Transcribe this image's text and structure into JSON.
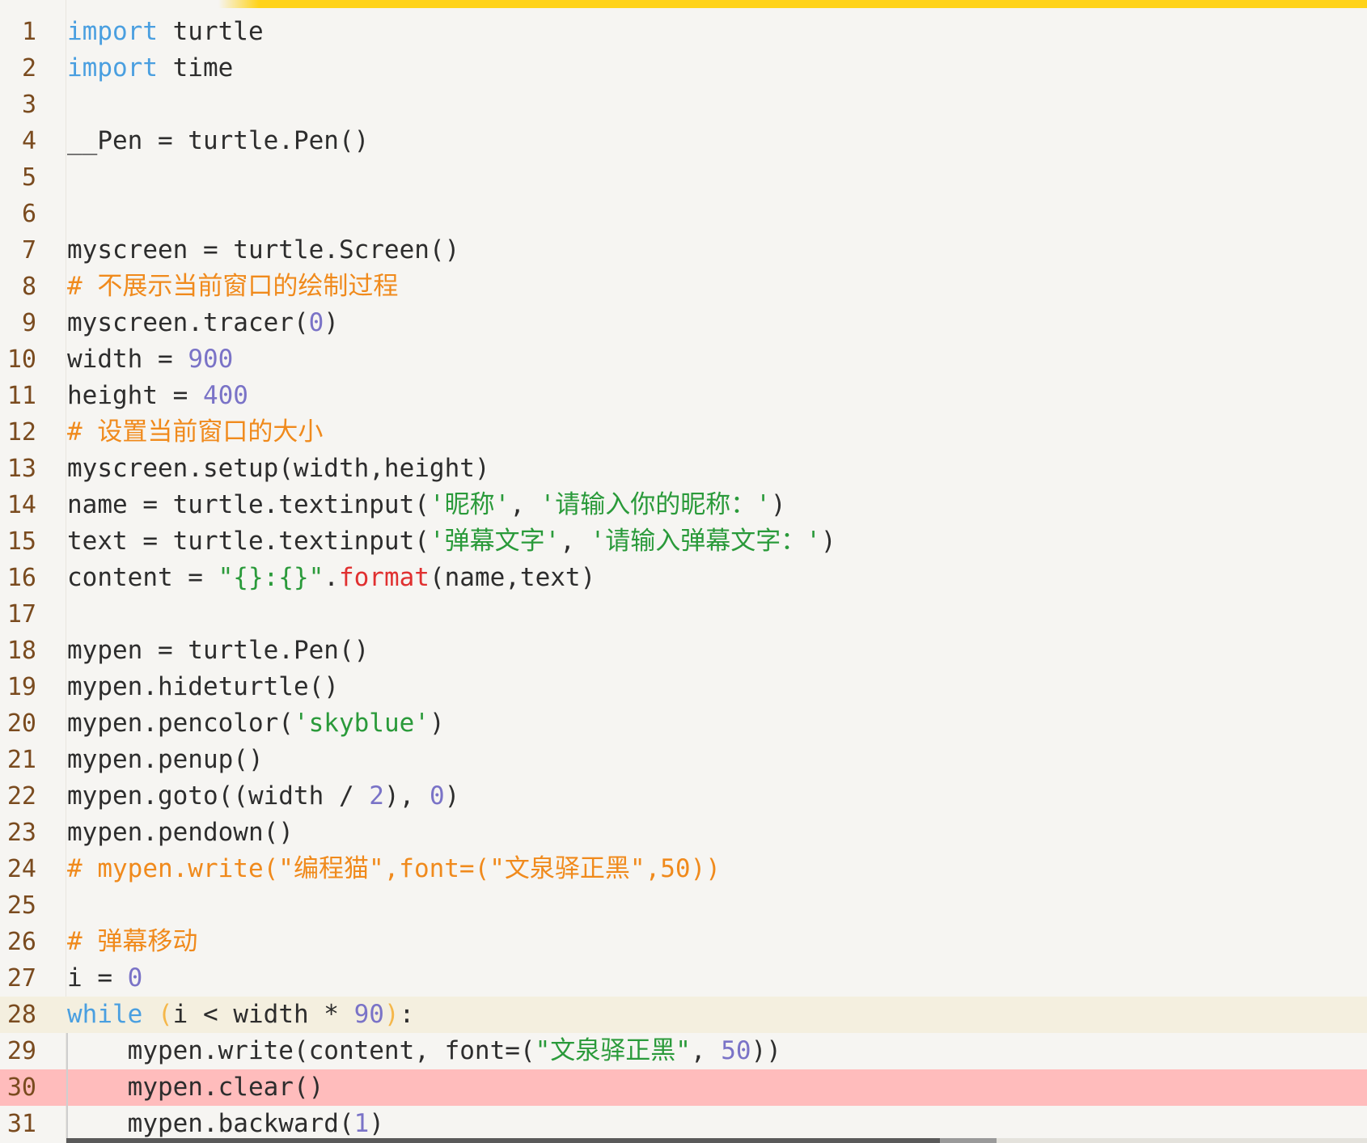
{
  "editor": {
    "language": "python",
    "active_line": 28,
    "error_line": 30,
    "lines": [
      {
        "num": "1",
        "tokens": [
          {
            "t": "import",
            "k": "kw"
          },
          {
            "t": " turtle",
            "k": "p"
          }
        ]
      },
      {
        "num": "2",
        "tokens": [
          {
            "t": "import",
            "k": "kw"
          },
          {
            "t": " time",
            "k": "p"
          }
        ]
      },
      {
        "num": "3",
        "tokens": []
      },
      {
        "num": "4",
        "tokens": [
          {
            "t": "__Pen = turtle.Pen()",
            "k": "p"
          }
        ]
      },
      {
        "num": "5",
        "tokens": []
      },
      {
        "num": "6",
        "tokens": []
      },
      {
        "num": "7",
        "tokens": [
          {
            "t": "myscreen = turtle.Screen()",
            "k": "p"
          }
        ]
      },
      {
        "num": "8",
        "tokens": [
          {
            "t": "# 不展示当前窗口的绘制过程",
            "k": "com"
          }
        ]
      },
      {
        "num": "9",
        "tokens": [
          {
            "t": "myscreen.tracer(",
            "k": "p"
          },
          {
            "t": "0",
            "k": "num"
          },
          {
            "t": ")",
            "k": "p"
          }
        ]
      },
      {
        "num": "10",
        "tokens": [
          {
            "t": "width = ",
            "k": "p"
          },
          {
            "t": "900",
            "k": "num"
          }
        ]
      },
      {
        "num": "11",
        "tokens": [
          {
            "t": "height = ",
            "k": "p"
          },
          {
            "t": "400",
            "k": "num"
          }
        ]
      },
      {
        "num": "12",
        "tokens": [
          {
            "t": "# 设置当前窗口的大小",
            "k": "com"
          }
        ]
      },
      {
        "num": "13",
        "tokens": [
          {
            "t": "myscreen.setup(width,height)",
            "k": "p"
          }
        ]
      },
      {
        "num": "14",
        "tokens": [
          {
            "t": "name = turtle.textinput(",
            "k": "p"
          },
          {
            "t": "'昵称'",
            "k": "str"
          },
          {
            "t": ", ",
            "k": "p"
          },
          {
            "t": "'请输入你的昵称：'",
            "k": "str"
          },
          {
            "t": ")",
            "k": "p"
          }
        ]
      },
      {
        "num": "15",
        "tokens": [
          {
            "t": "text = turtle.textinput(",
            "k": "p"
          },
          {
            "t": "'弹幕文字'",
            "k": "str"
          },
          {
            "t": ", ",
            "k": "p"
          },
          {
            "t": "'请输入弹幕文字：'",
            "k": "str"
          },
          {
            "t": ")",
            "k": "p"
          }
        ]
      },
      {
        "num": "16",
        "tokens": [
          {
            "t": "content = ",
            "k": "p"
          },
          {
            "t": "\"{}:{}\"",
            "k": "str"
          },
          {
            "t": ".",
            "k": "p"
          },
          {
            "t": "format",
            "k": "fn"
          },
          {
            "t": "(name,text)",
            "k": "p"
          }
        ]
      },
      {
        "num": "17",
        "tokens": []
      },
      {
        "num": "18",
        "tokens": [
          {
            "t": "mypen = turtle.Pen()",
            "k": "p"
          }
        ]
      },
      {
        "num": "19",
        "tokens": [
          {
            "t": "mypen.hideturtle()",
            "k": "p"
          }
        ]
      },
      {
        "num": "20",
        "tokens": [
          {
            "t": "mypen.pencolor(",
            "k": "p"
          },
          {
            "t": "'skyblue'",
            "k": "str"
          },
          {
            "t": ")",
            "k": "p"
          }
        ]
      },
      {
        "num": "21",
        "tokens": [
          {
            "t": "mypen.penup()",
            "k": "p"
          }
        ]
      },
      {
        "num": "22",
        "tokens": [
          {
            "t": "mypen.goto((width / ",
            "k": "p"
          },
          {
            "t": "2",
            "k": "num"
          },
          {
            "t": "), ",
            "k": "p"
          },
          {
            "t": "0",
            "k": "num"
          },
          {
            "t": ")",
            "k": "p"
          }
        ]
      },
      {
        "num": "23",
        "tokens": [
          {
            "t": "mypen.pendown()",
            "k": "p"
          }
        ]
      },
      {
        "num": "24",
        "tokens": [
          {
            "t": "# mypen.write(\"编程猫\",font=(\"文泉驿正黑\",50))",
            "k": "com"
          }
        ]
      },
      {
        "num": "25",
        "tokens": []
      },
      {
        "num": "26",
        "tokens": [
          {
            "t": "# 弹幕移动",
            "k": "com"
          }
        ]
      },
      {
        "num": "27",
        "tokens": [
          {
            "t": "i = ",
            "k": "p"
          },
          {
            "t": "0",
            "k": "num"
          }
        ]
      },
      {
        "num": "28",
        "tokens": [
          {
            "t": "while",
            "k": "kw"
          },
          {
            "t": " ",
            "k": "p"
          },
          {
            "t": "(",
            "k": "par"
          },
          {
            "t": "i < width * ",
            "k": "p"
          },
          {
            "t": "90",
            "k": "num"
          },
          {
            "t": ")",
            "k": "par"
          },
          {
            "t": ":",
            "k": "p"
          }
        ]
      },
      {
        "num": "29",
        "indent": true,
        "tokens": [
          {
            "t": "    mypen.write(content, font=(",
            "k": "p"
          },
          {
            "t": "\"文泉驿正黑\"",
            "k": "str"
          },
          {
            "t": ", ",
            "k": "p"
          },
          {
            "t": "50",
            "k": "num"
          },
          {
            "t": "))",
            "k": "p"
          }
        ]
      },
      {
        "num": "30",
        "indent": true,
        "tokens": [
          {
            "t": "    mypen.clear()",
            "k": "p"
          }
        ]
      },
      {
        "num": "31",
        "indent": true,
        "tokens": [
          {
            "t": "    mypen.backward(",
            "k": "p"
          },
          {
            "t": "1",
            "k": "num"
          },
          {
            "t": ")",
            "k": "p"
          }
        ]
      }
    ]
  },
  "colors": {
    "background": "#f6f5f2",
    "accent_bar": "#ffd31a",
    "keyword": "#4a9fe0",
    "number": "#7a73c7",
    "string": "#2a9a3a",
    "comment": "#f08a1c",
    "builtin_method": "#e03030",
    "line_number": "#7a4b1f",
    "active_line_bg": "#f4efdf",
    "error_line_bg": "#ffbcbc"
  }
}
